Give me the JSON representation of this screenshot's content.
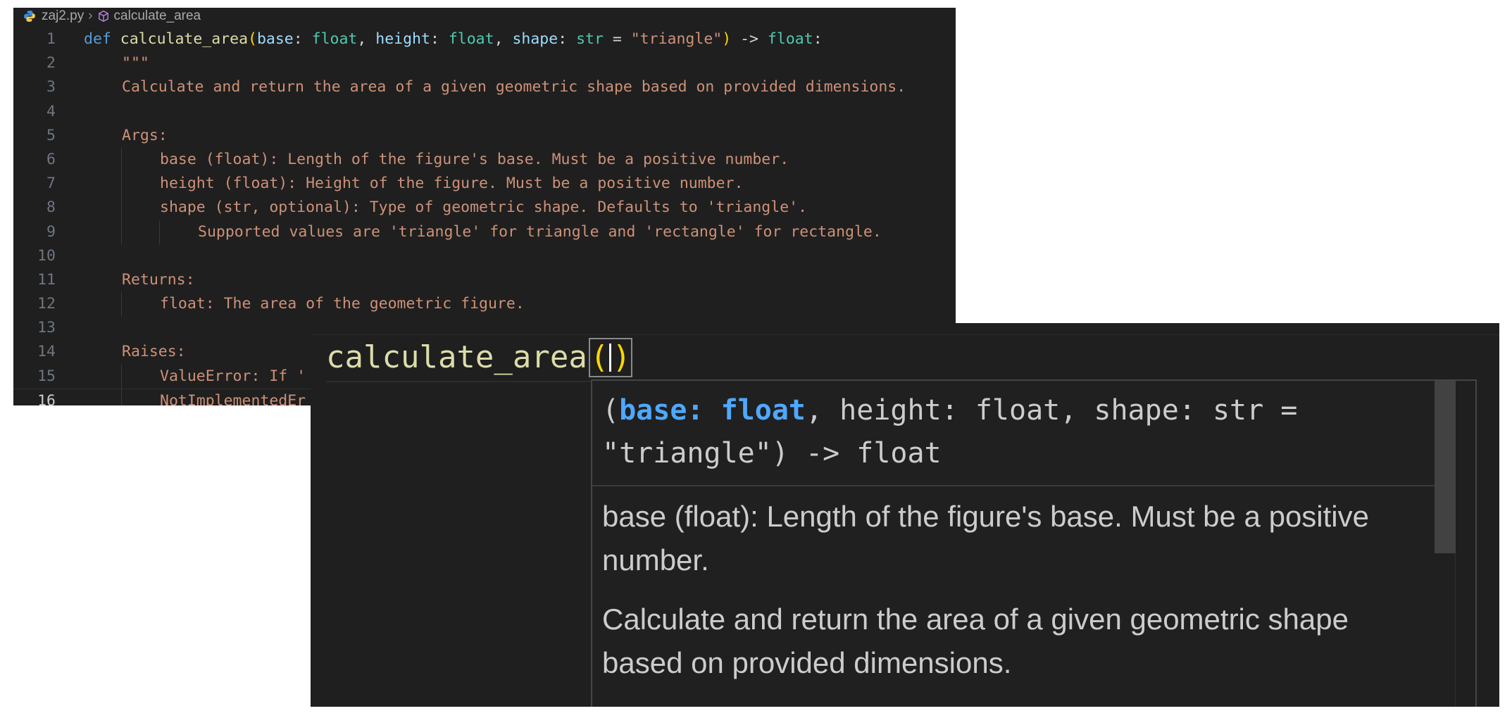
{
  "breadcrumb": {
    "file": "zaj2.py",
    "symbol": "calculate_area"
  },
  "editor": {
    "line_numbers": [
      "1",
      "2",
      "3",
      "4",
      "5",
      "6",
      "7",
      "8",
      "9",
      "10",
      "11",
      "12",
      "13",
      "14",
      "15",
      "16"
    ],
    "def_line": {
      "kw": "def",
      "name": "calculate_area",
      "open": "(",
      "p1": "base",
      "c1": ": ",
      "t1": "float",
      "sep1": ", ",
      "p2": "height",
      "c2": ": ",
      "t2": "float",
      "sep2": ", ",
      "p3": "shape",
      "c3": ": ",
      "t3": "str",
      "eq": " = ",
      "def_val": "\"triangle\"",
      "close": ")",
      "arrow": " -> ",
      "ret": "float",
      "colon": ":"
    },
    "doc_lines": [
      "\"\"\"",
      "Calculate and return the area of a given geometric shape based on provided dimensions.",
      "",
      "Args:",
      "base (float): Length of the figure's base. Must be a positive number.",
      "height (float): Height of the figure. Must be a positive number.",
      "shape (str, optional): Type of geometric shape. Defaults to 'triangle'.",
      "Supported values are 'triangle' for triangle and 'rectangle' for rectangle.",
      "",
      "Returns:",
      "float: The area of the geometric figure.",
      "",
      "Raises:",
      "ValueError: If '",
      "NotImplementedEr"
    ]
  },
  "zoom": {
    "call_name": "calculate_area",
    "open_paren": "(",
    "close_paren": ")",
    "signature": {
      "open": "(",
      "active_param": "base: float",
      "rest": ", height: float, shape: str = \"triangle\") -> float"
    },
    "param_doc": "base (float): Length of the figure's base. Must be a positive number.",
    "summary_doc": "Calculate and return the area of a given geometric shape based on provided dimensions."
  },
  "colors": {
    "editor_bg": "#1f1f1f",
    "keyword": "#569cd6",
    "function": "#dcdcaa",
    "param": "#9cdcfe",
    "type": "#4ec9b0",
    "string": "#ce9178",
    "bracket": "#ffd700",
    "active_param": "#4fa8ff"
  },
  "icons": {
    "file": "python-file-icon",
    "symbol": "symbol-method-icon",
    "breadcrumb_sep": "chevron-right-icon"
  }
}
